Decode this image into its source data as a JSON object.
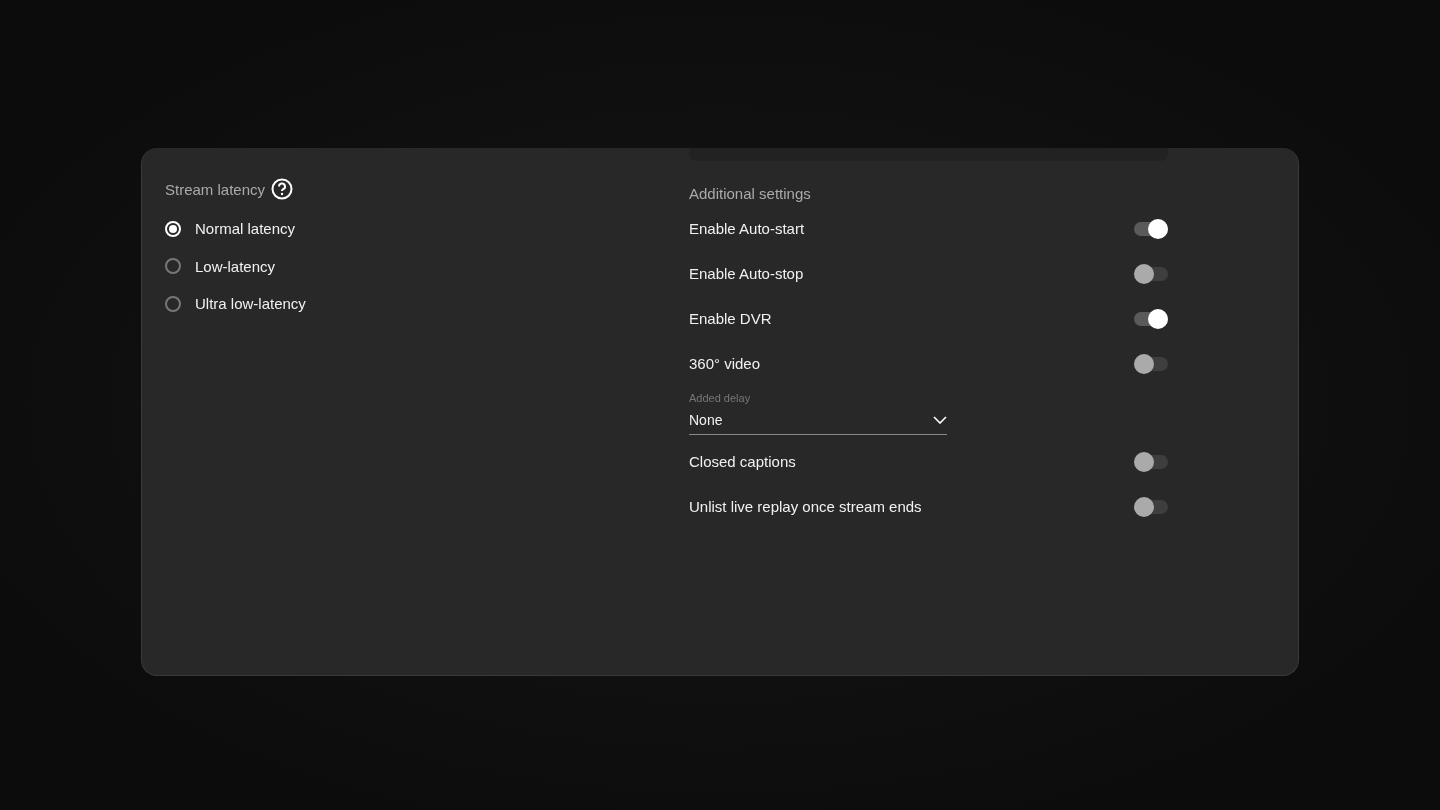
{
  "stream_latency": {
    "title": "Stream latency",
    "options": [
      {
        "label": "Normal latency",
        "selected": true
      },
      {
        "label": "Low-latency",
        "selected": false
      },
      {
        "label": "Ultra low-latency",
        "selected": false
      }
    ]
  },
  "additional_settings": {
    "title": "Additional settings",
    "items": [
      {
        "kind": "toggle",
        "label": "Enable Auto-start",
        "on": true
      },
      {
        "kind": "toggle",
        "label": "Enable Auto-stop",
        "on": false
      },
      {
        "kind": "toggle",
        "label": "Enable DVR",
        "on": true
      },
      {
        "kind": "toggle",
        "label": "360° video",
        "on": false
      },
      {
        "kind": "select",
        "label": "Added delay",
        "value": "None"
      },
      {
        "kind": "toggle",
        "label": "Closed captions",
        "on": false
      },
      {
        "kind": "toggle",
        "label": "Unlist live replay once stream ends",
        "on": false
      }
    ]
  }
}
